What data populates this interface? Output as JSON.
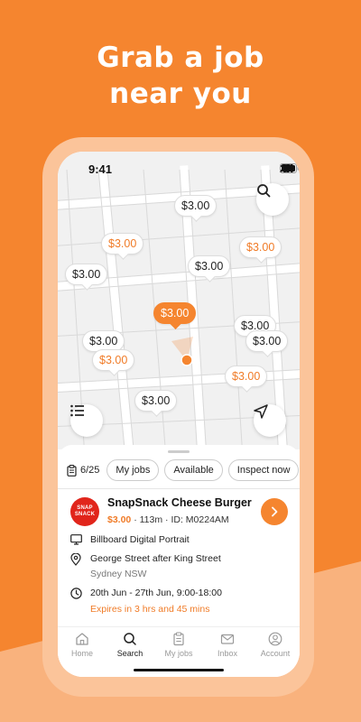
{
  "headline": {
    "line1": "Grab a job",
    "line2": "near you"
  },
  "status_bar": {
    "time": "9:41"
  },
  "map": {
    "pins": [
      {
        "label": "$3.00",
        "style": "dark"
      },
      {
        "label": "$3.00",
        "style": "orange"
      },
      {
        "label": "$3.00",
        "style": "orange"
      },
      {
        "label": "$3.00",
        "style": "dark"
      },
      {
        "label": "$3.00",
        "style": "dark"
      },
      {
        "label": "$3.00",
        "style": "active"
      },
      {
        "label": "$3.00",
        "style": "dark"
      },
      {
        "label": "$3.00",
        "style": "dark"
      },
      {
        "label": "$3.00",
        "style": "dark"
      },
      {
        "label": "$3.00",
        "style": "orange"
      },
      {
        "label": "$3.00",
        "style": "orange"
      },
      {
        "label": "$3.00",
        "style": "dark"
      }
    ]
  },
  "filters": {
    "count": "6/25",
    "chips": [
      "My jobs",
      "Available",
      "Inspect now"
    ]
  },
  "job": {
    "brand_logo_text": "SNAP SNACK",
    "title": "SnapSnack Cheese Burger",
    "price": "$3.00",
    "distance": "113m",
    "id": "ID: M0224AM",
    "separator": "·",
    "media": "Billboard Digital Portrait",
    "address_line1": "George Street after King Street",
    "address_line2": "Sydney NSW",
    "schedule": "20th Jun - 27th Jun, 9:00-18:00",
    "expiry": "Expires in 3 hrs and 45 mins"
  },
  "tabs": [
    {
      "label": "Home",
      "icon": "home-icon"
    },
    {
      "label": "Search",
      "icon": "search-icon",
      "active": true
    },
    {
      "label": "My jobs",
      "icon": "clipboard-icon"
    },
    {
      "label": "Inbox",
      "icon": "mail-icon"
    },
    {
      "label": "Account",
      "icon": "user-icon"
    }
  ],
  "colors": {
    "accent": "#f5852f",
    "price": "#f07b27",
    "brand_red": "#e1251b"
  }
}
